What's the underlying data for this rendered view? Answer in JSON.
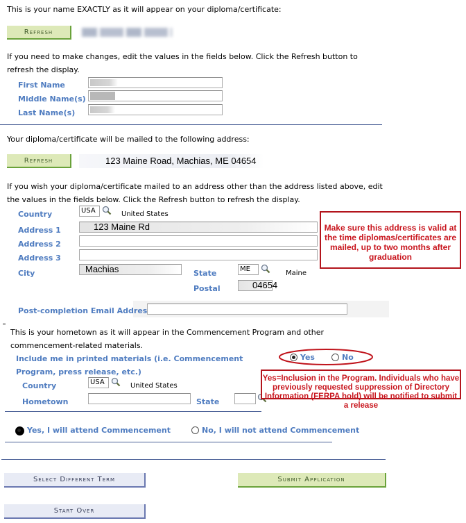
{
  "name_section": {
    "intro": "This is your name EXACTLY as it will appear on your diploma/certificate:",
    "refresh_label": "Refresh",
    "instructions": "If you need to make changes, edit the values in the fields below. Click the Refresh button to refresh the display.",
    "fields": {
      "first_name_label": "First Name",
      "middle_name_label": "Middle Name(s)",
      "last_name_label": "Last Name(s)"
    }
  },
  "address_section": {
    "intro": "Your diploma/certificate will be mailed to the following address:",
    "refresh_label": "Refresh",
    "current_address": "123 Maine Road, Machias, ME 04654",
    "instructions": "If you wish your diploma/certificate mailed to an address other than the address listed above, edit the values in the fields below. Click the Refresh button to refresh the display.",
    "country_label": "Country",
    "country_code": "USA",
    "country_name": "United States",
    "address1_label": "Address 1",
    "address1_value": "123 Maine Rd",
    "address2_label": "Address 2",
    "address2_value": "",
    "address3_label": "Address 3",
    "address3_value": "",
    "city_label": "City",
    "city_value": "Machias",
    "state_label": "State",
    "state_code": "ME",
    "state_name": "Maine",
    "postal_label": "Postal",
    "postal_value": "04654",
    "email_label": "Post-completion Email Address",
    "email_value": "",
    "callout": "Make sure this address is valid at the time diplomas/certificates are mailed, up to two months after graduation"
  },
  "hometown_section": {
    "intro": "This is your hometown as it will appear in the Commencement Program and other commencement-related materials.",
    "include_label": "Include me in printed materials (i.e. Commencement Program, press release, etc.)",
    "yes_label": "Yes",
    "no_label": "No",
    "include_selected": "Yes",
    "country_label": "Country",
    "country_code": "USA",
    "country_name": "United States",
    "hometown_label": "Hometown",
    "hometown_value": "",
    "state_label": "State",
    "state_value": "",
    "callout": "Yes=Inclusion in the Program. Individuals who have previously requested suppression of Directory Information (FERPA hold) will be notified to submit a release"
  },
  "attendance": {
    "yes_label": "Yes, I will attend Commencement",
    "no_label": "No, I will not attend Commencement",
    "selected": "Yes"
  },
  "actions": {
    "select_term_label": "Select Different Term",
    "submit_label": "Submit Application",
    "start_over_label": "Start Over"
  },
  "colors": {
    "label_blue": "#4f7cc0",
    "callout_red": "#c8141c",
    "green_button": "#dde9b8",
    "blue_button": "#e8ebf5",
    "divider": "#4a5f96"
  }
}
